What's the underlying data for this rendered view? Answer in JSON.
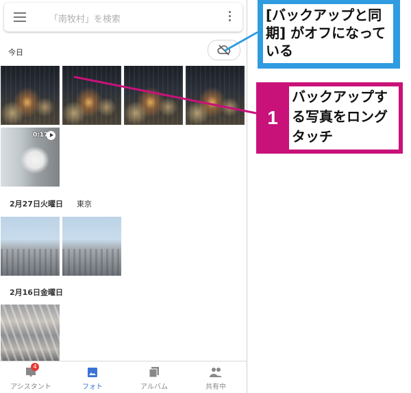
{
  "search": {
    "placeholder": "「南牧村」を検索"
  },
  "sections": [
    {
      "date": "今日",
      "location": ""
    },
    {
      "date": "2月27日火曜日",
      "location": "東京"
    },
    {
      "date": "2月16日金曜日",
      "location": ""
    }
  ],
  "video": {
    "duration": "0:17"
  },
  "bottom_nav": {
    "items": [
      {
        "label": "アシスタント",
        "badge": "4",
        "icon": "assistant-icon"
      },
      {
        "label": "フォト",
        "icon": "photos-icon",
        "active": true
      },
      {
        "label": "アルバム",
        "icon": "albums-icon"
      },
      {
        "label": "共有中",
        "icon": "sharing-icon"
      }
    ],
    "active_color": "#3b73d6"
  },
  "annotations": {
    "backup_off": {
      "text": "[バックアップと同期] がオフになっている",
      "border_color": "#2f9be0"
    },
    "step1": {
      "number": "1",
      "text": "バックアップする写真をロングタッチ",
      "color": "#c8127a"
    }
  },
  "icons": {
    "menu": "menu-icon",
    "more": "more-vert-icon",
    "cloud_off": "cloud-off-icon",
    "play": "play-icon"
  }
}
